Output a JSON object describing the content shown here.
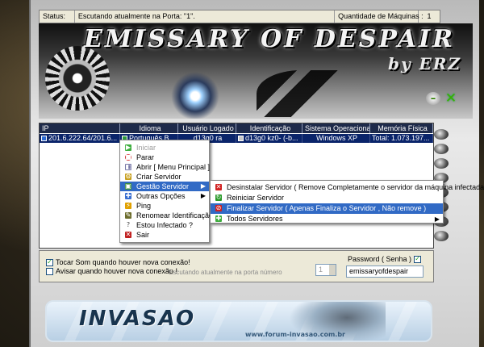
{
  "status": {
    "label": "Status:",
    "text": "Escutando atualmente na Porta: \"1\".",
    "count_label": "Quantidade de Máquinas :",
    "count_value": "1"
  },
  "banner": {
    "title": "EMISSARY OF DESPAIR",
    "subtitle": "by ERZ"
  },
  "grid": {
    "columns": [
      "IP",
      "Idioma",
      "Usuário Logado",
      "Identificação",
      "Sistema Operacional",
      "Memória Física"
    ],
    "rows": [
      {
        "ip": "201.6.222.64/201.6...",
        "idioma": "Português B...",
        "usuario": "d13g0 ra",
        "identificacao": "d13g0 kz0- (-b...",
        "so": "Windows XP",
        "memoria": "Total: 1.073.197..."
      }
    ]
  },
  "context_menu": {
    "items": [
      {
        "label": "Iniciar",
        "icon": "play-icon",
        "color": "#3fae3f",
        "disabled": true
      },
      {
        "label": "Parar",
        "icon": "stop-icon",
        "color": "#d03030"
      },
      {
        "label": "Abrir [ Menu Principal ]",
        "icon": "open-icon",
        "color": "#7a7aa8"
      },
      {
        "label": "Criar Servidor",
        "icon": "build-icon",
        "color": "#c8a020"
      },
      {
        "label": "Gestão Servidor",
        "icon": "server-icon",
        "color": "#3b8d3b",
        "highlighted": true,
        "submenu": true
      },
      {
        "label": "Outras Opções",
        "icon": "options-icon",
        "color": "#3a6fd0",
        "submenu": true
      },
      {
        "label": "Ping",
        "icon": "ping-icon",
        "color": "#e0a000"
      },
      {
        "label": "Renomear Identificação",
        "icon": "rename-icon",
        "color": "#6d6d2d"
      },
      {
        "label": "Estou Infectado ?",
        "icon": "question-icon",
        "color": "#888888"
      },
      {
        "label": "Sair",
        "icon": "exit-icon",
        "color": "#c02020"
      }
    ]
  },
  "submenu": {
    "items": [
      {
        "label": "Desinstalar Servidor ( Remove Completamente o servidor da máquina infectada )",
        "icon": "uninstall-icon",
        "color": "#d02020"
      },
      {
        "label": "Reiniciar Servidor",
        "icon": "restart-icon",
        "color": "#2a9a2a"
      },
      {
        "label": "Finalizar  Servidor ( Apenas Finaliza o Servidor , Não remove )",
        "icon": "finalize-icon",
        "color": "#d02020",
        "highlighted": true
      },
      {
        "label": "Todos Servidores",
        "icon": "all-servers-icon",
        "color": "#3fae3f",
        "submenu": true
      }
    ]
  },
  "options": {
    "sound_label": "Tocar Som quando houver nova conexão!",
    "sound_checked": true,
    "notify_label": "Avisar quando houver nova conexão !",
    "notify_checked": false,
    "port_label": "Escutando atualmente na porta número",
    "port_value": "1",
    "password_label": "Password ( Senha )",
    "password_checked": true,
    "password_value": "emissaryofdespair"
  },
  "footer": {
    "logo": "INVASAO",
    "url": "www.forum-invasao.com.br"
  },
  "colors": {
    "selection": "#0a246a",
    "menu_highlight": "#316ac5",
    "grid_header": "#1e2a4a"
  }
}
